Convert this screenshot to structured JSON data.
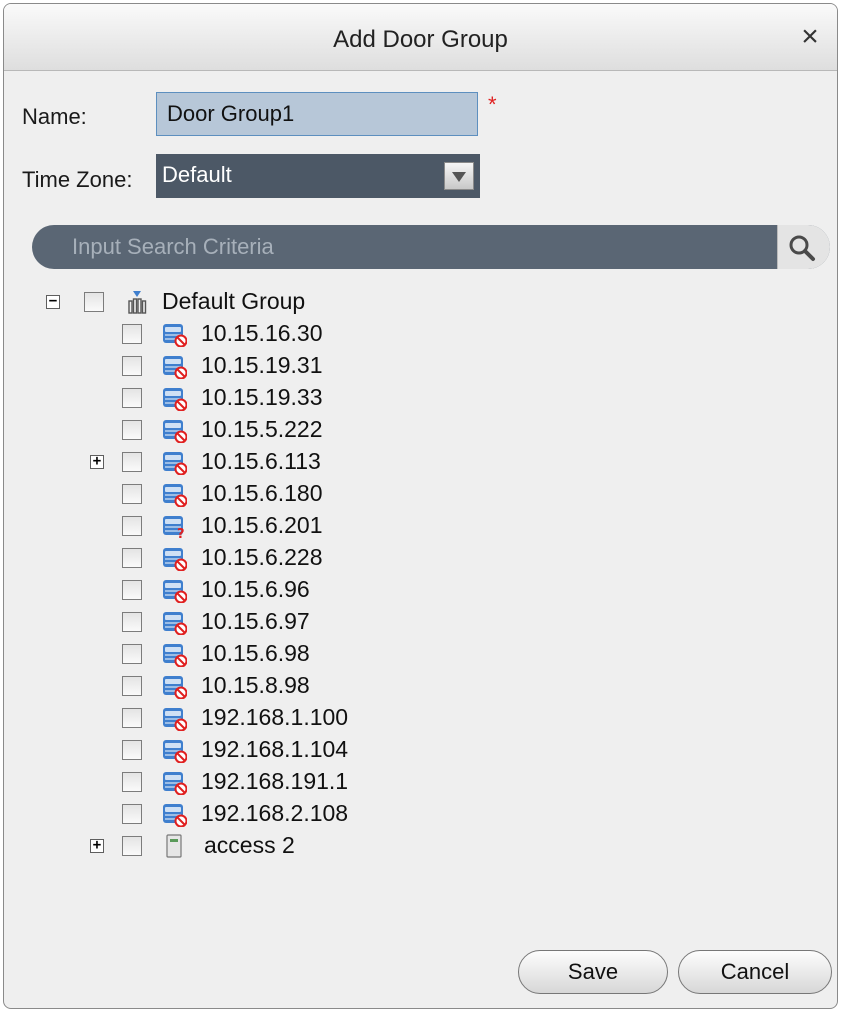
{
  "dialog": {
    "title": "Add Door Group",
    "close_symbol": "×"
  },
  "form": {
    "name_label": "Name:",
    "name_value": "Door Group1",
    "required_mark": "*",
    "timezone_label": "Time Zone:",
    "timezone_value": "Default"
  },
  "search": {
    "placeholder": "Input Search Criteria"
  },
  "tree": {
    "root_label": "Default Group",
    "root_expander": "−",
    "devices": [
      {
        "label": "10.15.16.30",
        "status": "offline",
        "expandable": false
      },
      {
        "label": "10.15.19.31",
        "status": "offline",
        "expandable": false
      },
      {
        "label": "10.15.19.33",
        "status": "offline",
        "expandable": false
      },
      {
        "label": "10.15.5.222",
        "status": "offline",
        "expandable": false
      },
      {
        "label": "10.15.6.113",
        "status": "offline",
        "expandable": true
      },
      {
        "label": "10.15.6.180",
        "status": "offline",
        "expandable": false
      },
      {
        "label": "10.15.6.201",
        "status": "unknown",
        "expandable": false
      },
      {
        "label": "10.15.6.228",
        "status": "offline",
        "expandable": false
      },
      {
        "label": "10.15.6.96",
        "status": "offline",
        "expandable": false
      },
      {
        "label": "10.15.6.97",
        "status": "offline",
        "expandable": false
      },
      {
        "label": "10.15.6.98",
        "status": "offline",
        "expandable": false
      },
      {
        "label": "10.15.8.98",
        "status": "offline",
        "expandable": false
      },
      {
        "label": "192.168.1.100",
        "status": "offline",
        "expandable": false
      },
      {
        "label": "192.168.1.104",
        "status": "offline",
        "expandable": false
      },
      {
        "label": "192.168.191.1",
        "status": "offline",
        "expandable": false
      },
      {
        "label": "192.168.2.108",
        "status": "offline",
        "expandable": false
      },
      {
        "label": "access 2",
        "status": "access",
        "expandable": true
      }
    ]
  },
  "buttons": {
    "save": "Save",
    "cancel": "Cancel"
  },
  "colors": {
    "offline_badge": "#e02020",
    "device_icon": "#3f7fce",
    "required": "#e02020"
  }
}
